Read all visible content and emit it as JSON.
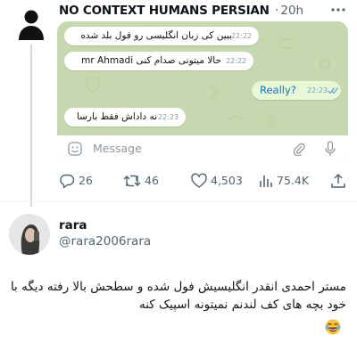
{
  "tweet": {
    "author_name": "NO CONTEXT HUMANS PERSIAN",
    "separator": "·",
    "time": "20h",
    "chat": {
      "messages": [
        {
          "text": "ببین کی زبان انگلیسی رو فول بلد شده",
          "time": "22:22",
          "side": "incoming"
        },
        {
          "text": "حالا میتونی صدام کنی mr Ahmadi",
          "time": "22:22",
          "side": "incoming"
        },
        {
          "text": "Really?",
          "time": "22:23",
          "side": "outgoing",
          "status": "read"
        },
        {
          "text": "نه داداش فقط بارسا",
          "time": "22:23",
          "side": "incoming"
        }
      ],
      "input_placeholder": "Message",
      "background_color": "#c6d8b0"
    },
    "actions": {
      "replies": "26",
      "retweets": "46",
      "likes": "4,503",
      "views": "75.4K"
    }
  },
  "reply": {
    "name": "rara",
    "handle": "@rara2006rara",
    "text": "مستر احمدی انقدر انگلیسیش فول شده و سطحش بالا رفته دیگه با خود بچه های کف لندنم نمیتونه اسپیک کنه",
    "emoji": "😂"
  },
  "colors": {
    "text": "#0f1419",
    "secondary": "#536471",
    "outgoing_bubble": "#e8f8d6",
    "link_blue": "#1d6fb3"
  },
  "icons": [
    "default-avatar-icon",
    "more-icon",
    "emoji-icon",
    "attach-icon",
    "mic-icon",
    "double-check-icon",
    "reply-icon",
    "retweet-icon",
    "like-icon",
    "views-icon",
    "share-icon",
    "laugh-emoji"
  ]
}
